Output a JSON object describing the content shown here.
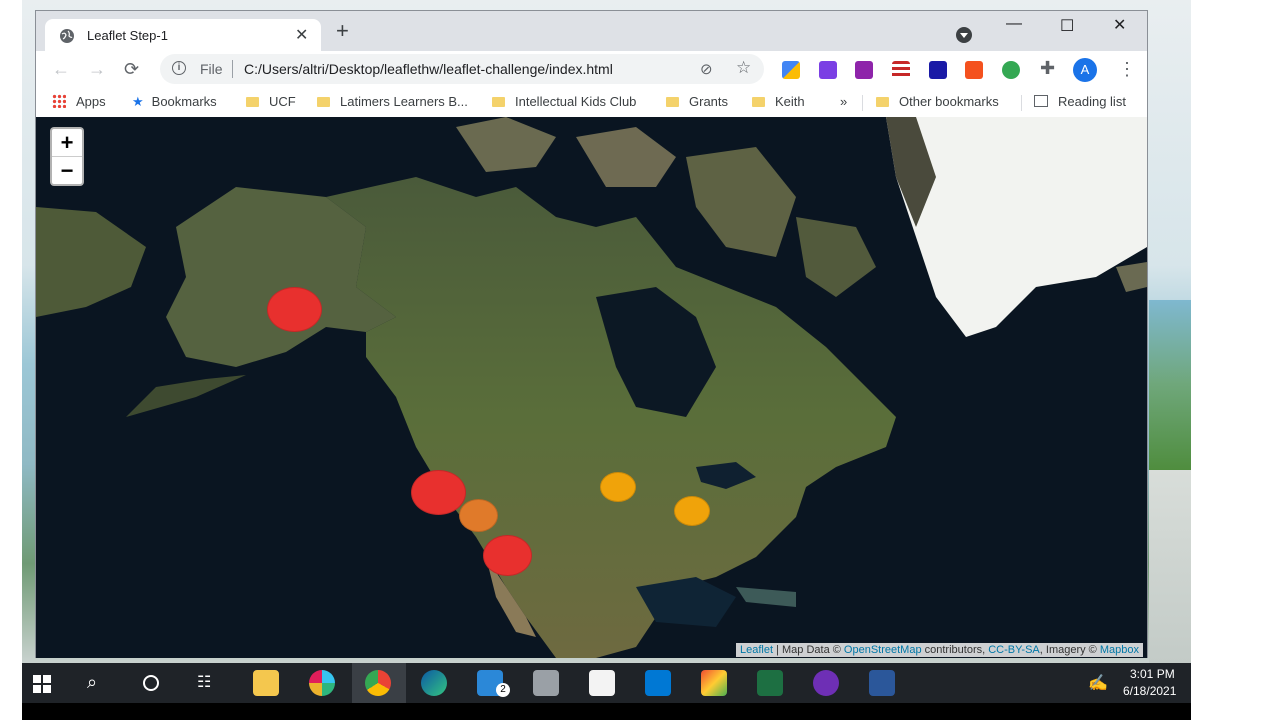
{
  "tab": {
    "title": "Leaflet Step-1",
    "close": "✕",
    "new": "+"
  },
  "window": {
    "minimize": "—",
    "maximize": "☐",
    "close": "✕"
  },
  "toolbar": {
    "back": "←",
    "forward": "→",
    "reload": "⟳",
    "scheme": "File",
    "url": "C:/Users/altri/Desktop/leaflethw/leaflet-challenge/index.html",
    "avatar": "A",
    "menu": "⋮"
  },
  "bookmarks": {
    "apps": "Apps",
    "bookmarks": "Bookmarks",
    "items": [
      "UCF",
      "Latimers Learners B...",
      "Intellectual Kids Club",
      "Grants",
      "Keith"
    ],
    "more": "»",
    "other": "Other bookmarks",
    "reading": "Reading list"
  },
  "map": {
    "zoom_in": "+",
    "zoom_out": "−",
    "attribution": {
      "leaflet": "Leaflet",
      "sep1": " | Map Data © ",
      "osm": "OpenStreetMap",
      "contributors": " contributors, ",
      "license": "CC-BY-SA",
      "imagery": ", Imagery © ",
      "mapbox": "Mapbox"
    },
    "markers": [
      {
        "name": "alaska",
        "color": "#e8302e"
      },
      {
        "name": "northern-california",
        "color": "#e8302e"
      },
      {
        "name": "central-california",
        "color": "#e07a2a"
      },
      {
        "name": "southern-california",
        "color": "#e8302e"
      },
      {
        "name": "central-plains",
        "color": "#f0a30a"
      },
      {
        "name": "midwest",
        "color": "#f0a30a"
      }
    ]
  },
  "taskbar": {
    "time": "3:01 PM",
    "date": "6/18/2021",
    "mail_badge": "2"
  }
}
